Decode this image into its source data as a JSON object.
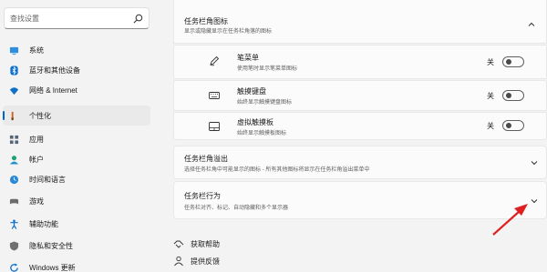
{
  "search": {
    "placeholder": "查找设置"
  },
  "sidebar": {
    "items": [
      {
        "label": "系统",
        "icon": "monitor-icon",
        "color": "#0067c0"
      },
      {
        "label": "蓝牙和其他设备",
        "icon": "bluetooth-icon",
        "color": "#0067c0"
      },
      {
        "label": "网络 & Internet",
        "icon": "wifi-icon",
        "color": "#0067c0"
      },
      {
        "label": "个性化",
        "icon": "brush-icon",
        "color": "#c05a1a",
        "active": true
      },
      {
        "label": "应用",
        "icon": "apps-icon",
        "color": "#4a5a6a"
      },
      {
        "label": "帐户",
        "icon": "account-icon",
        "color": "#1a9a6a"
      },
      {
        "label": "时间和语言",
        "icon": "globe-clock-icon",
        "color": "#0067c0"
      },
      {
        "label": "游戏",
        "icon": "gamepad-icon",
        "color": "#6a6a6a"
      },
      {
        "label": "辅助功能",
        "icon": "accessibility-icon",
        "color": "#0067c0"
      },
      {
        "label": "隐私和安全性",
        "icon": "shield-icon",
        "color": "#6a6a6a"
      },
      {
        "label": "Windows 更新",
        "icon": "update-icon",
        "color": "#0067c0"
      }
    ]
  },
  "main": {
    "corner_icons": {
      "title": "任务栏角图标",
      "desc": "显示或隐藏显示在任务栏角落的图标",
      "rows": [
        {
          "title": "笔菜单",
          "desc": "使用笔时显示笔菜单图标",
          "state": "关",
          "icon": "pen-icon",
          "on": false
        },
        {
          "title": "触摸键盘",
          "desc": "始终显示触摸键盘图标",
          "state": "关",
          "icon": "keyboard-icon",
          "on": false
        },
        {
          "title": "虚拟触摸板",
          "desc": "始终显示触摸板图标",
          "state": "关",
          "icon": "touchpad-icon",
          "on": false
        }
      ]
    },
    "overflow": {
      "title": "任务栏角溢出",
      "desc": "选择任务栏角中可能显示的图标 - 所有其他图标将显示在任务栏角溢出菜单中"
    },
    "behavior": {
      "title": "任务栏行为",
      "desc": "任务栏对齐、标记、自动隐藏和多个显示器"
    },
    "links": [
      {
        "label": "获取帮助",
        "icon": "help-icon"
      },
      {
        "label": "提供反馈",
        "icon": "feedback-icon"
      }
    ]
  },
  "colors": {
    "accent": "#0067c0",
    "annotation_arrow": "#e02020"
  }
}
